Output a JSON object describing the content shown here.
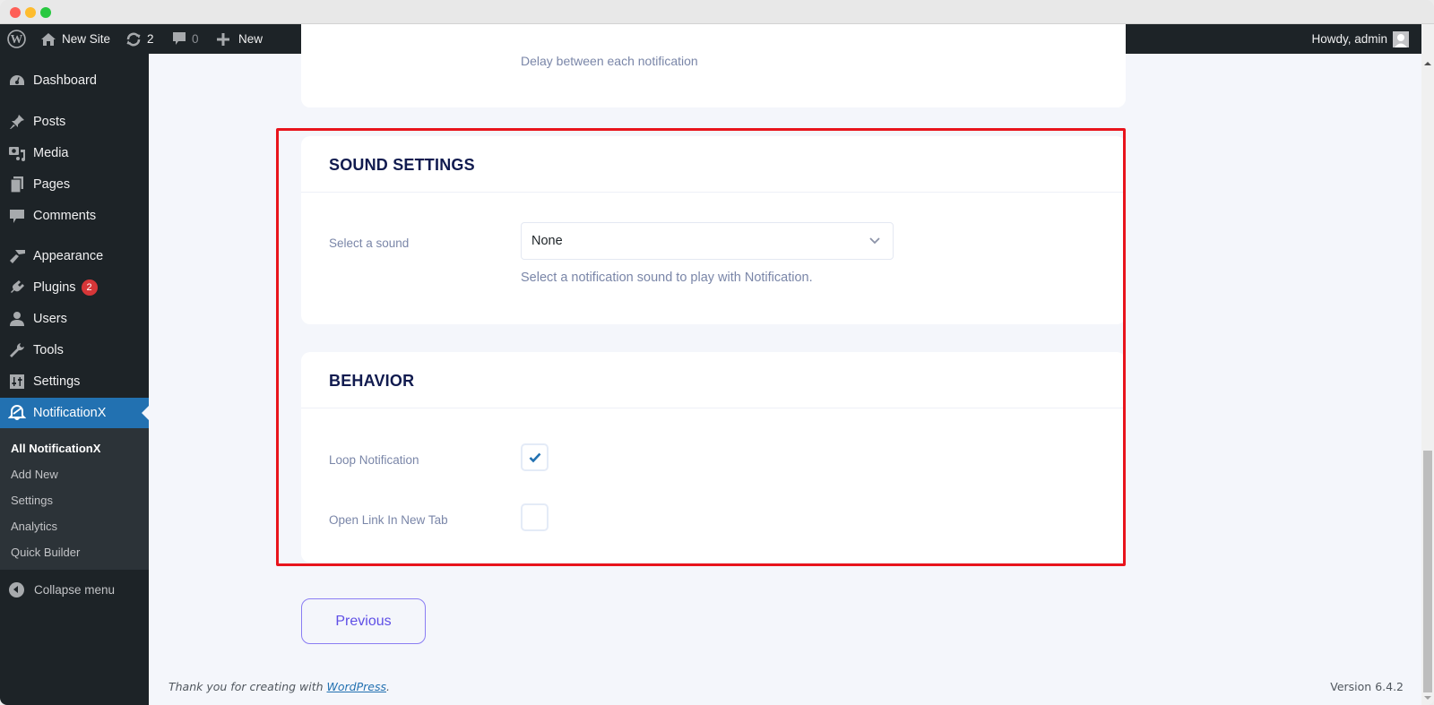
{
  "window": {
    "controls": [
      "close",
      "minimize",
      "maximize"
    ]
  },
  "adminbar": {
    "wp_logo_icon": "wordpress-logo-icon",
    "site_name": "New Site",
    "updates_count": "2",
    "comments_count": "0",
    "new_label": "New",
    "greeting": "Howdy, admin"
  },
  "sidebar": {
    "items": [
      {
        "label": "Dashboard",
        "icon": "dashboard-icon"
      },
      {
        "label": "Posts",
        "icon": "pin-icon"
      },
      {
        "label": "Media",
        "icon": "media-icon"
      },
      {
        "label": "Pages",
        "icon": "pages-icon"
      },
      {
        "label": "Comments",
        "icon": "comment-icon"
      },
      {
        "label": "Appearance",
        "icon": "brush-icon"
      },
      {
        "label": "Plugins",
        "icon": "plug-icon",
        "badge": "2"
      },
      {
        "label": "Users",
        "icon": "user-icon"
      },
      {
        "label": "Tools",
        "icon": "wrench-icon"
      },
      {
        "label": "Settings",
        "icon": "sliders-icon"
      },
      {
        "label": "NotificationX",
        "icon": "bell-icon",
        "active": true
      }
    ],
    "submenu": [
      {
        "label": "All NotificationX",
        "current": true
      },
      {
        "label": "Add New"
      },
      {
        "label": "Settings"
      },
      {
        "label": "Analytics"
      },
      {
        "label": "Quick Builder"
      }
    ],
    "collapse_label": "Collapse menu"
  },
  "main": {
    "top_card": {
      "help_text": "Delay between each notification"
    },
    "sound_settings": {
      "title": "SOUND SETTINGS",
      "field_label": "Select a sound",
      "selected_value": "None",
      "help_text": "Select a notification sound to play with Notification."
    },
    "behavior": {
      "title": "BEHAVIOR",
      "fields": [
        {
          "label": "Loop Notification",
          "checked": true
        },
        {
          "label": "Open Link In New Tab",
          "checked": false
        }
      ]
    },
    "previous_label": "Previous",
    "highlight_color": "#e8141c"
  },
  "footer": {
    "thanks_prefix": "Thank you for creating with ",
    "thanks_link": "WordPress",
    "thanks_suffix": ".",
    "version": "Version 6.4.2"
  },
  "colors": {
    "adminbar_bg": "#1d2327",
    "active_menu": "#2271b1",
    "badge": "#d63638",
    "heading": "#111b4f",
    "muted_text": "#7a86a8",
    "accent_button": "#5f4fe6",
    "checkbox_tick": "#2271b1"
  }
}
